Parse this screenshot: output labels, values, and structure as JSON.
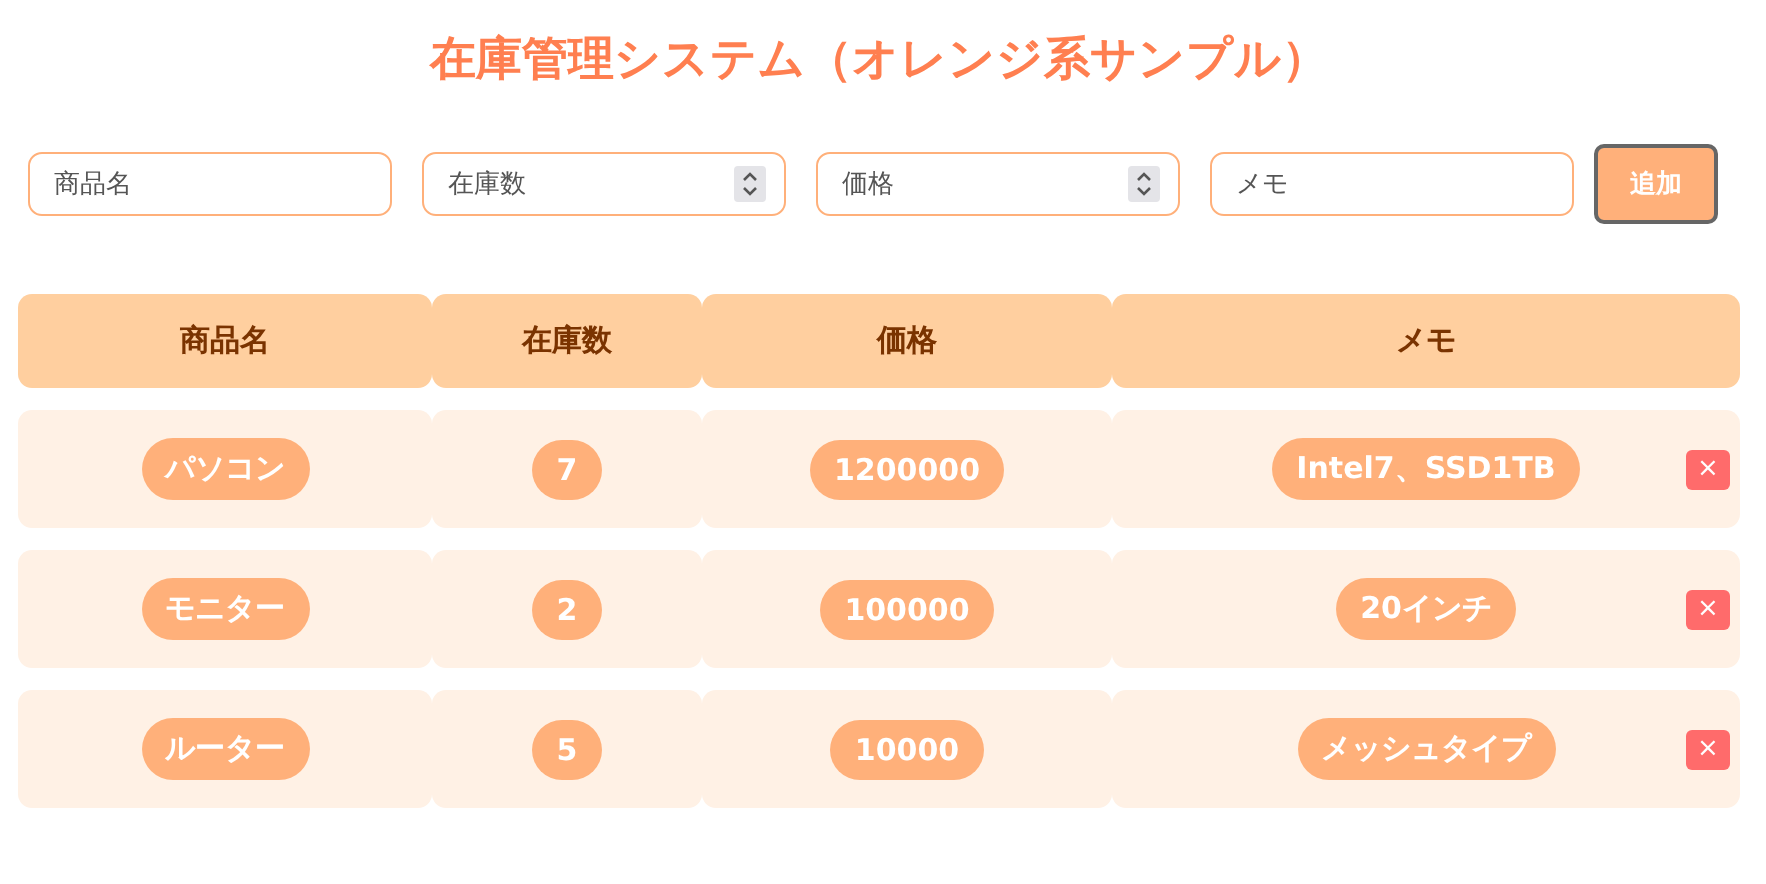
{
  "title": "在庫管理システム（オレンジ系サンプル）",
  "form": {
    "fields": [
      {
        "kind": "text",
        "placeholder": "商品名"
      },
      {
        "kind": "number",
        "placeholder": "在庫数"
      },
      {
        "kind": "number",
        "placeholder": "価格"
      },
      {
        "kind": "text",
        "placeholder": "メモ"
      }
    ],
    "add_button": "追加"
  },
  "table": {
    "columns": [
      "商品名",
      "在庫数",
      "価格",
      "メモ"
    ],
    "rows": [
      {
        "cells": [
          "パソコン",
          "7",
          "1200000",
          "Intel7、SSD1TB"
        ],
        "delete": "×"
      },
      {
        "cells": [
          "モニター",
          "2",
          "100000",
          "20インチ"
        ],
        "delete": "×"
      },
      {
        "cells": [
          "ルーター",
          "5",
          "10000",
          "メッシュタイプ"
        ],
        "delete": "×"
      }
    ]
  }
}
